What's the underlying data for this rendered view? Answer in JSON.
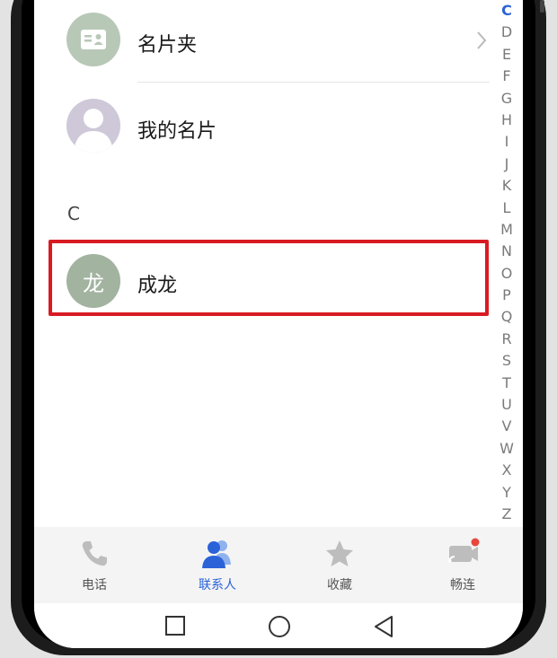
{
  "contacts_list": {
    "cardholder": {
      "label": "名片夹",
      "icon": "business-card-icon",
      "avatar_color": "#b8c8b7"
    },
    "my_card": {
      "label": "我的名片",
      "icon": "person-silhouette-icon",
      "avatar_color": "#cec8d8"
    },
    "section_header": "C",
    "contacts": [
      {
        "avatar_text": "龙",
        "name": "成龙",
        "avatar_color": "#a2b3a0",
        "highlighted": true
      }
    ]
  },
  "alphabet_index": {
    "letters": [
      "C",
      "D",
      "E",
      "F",
      "G",
      "H",
      "I",
      "J",
      "K",
      "L",
      "M",
      "N",
      "O",
      "P",
      "Q",
      "R",
      "S",
      "T",
      "U",
      "V",
      "W",
      "X",
      "Y",
      "Z"
    ],
    "active": "C"
  },
  "tab_bar": {
    "tabs": [
      {
        "label": "电话",
        "icon": "phone-icon",
        "active": false
      },
      {
        "label": "联系人",
        "icon": "contacts-icon",
        "active": true
      },
      {
        "label": "收藏",
        "icon": "star-icon",
        "active": false
      },
      {
        "label": "畅连",
        "icon": "meetime-icon",
        "active": false,
        "has_badge": true
      }
    ]
  },
  "nav_bar": {
    "buttons": [
      "recent-apps-icon",
      "home-icon",
      "back-icon"
    ]
  },
  "colors": {
    "accent": "#2b62d8",
    "highlight_border": "#d81b23",
    "badge": "#e8473c"
  }
}
